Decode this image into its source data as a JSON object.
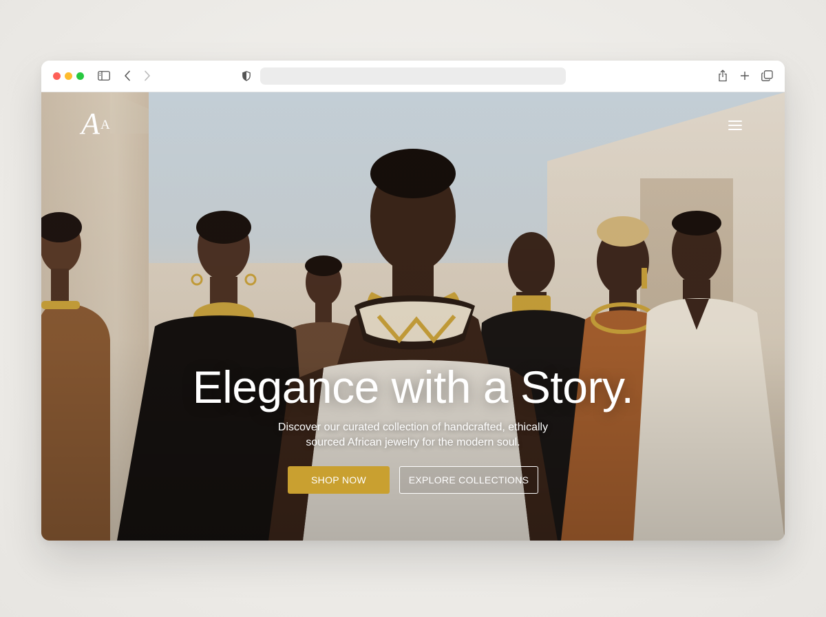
{
  "browser": {
    "address_value": "",
    "toolbar_icons": [
      "sidebar-icon",
      "back-icon",
      "forward-icon",
      "shield-icon",
      "share-icon",
      "new-tab-icon",
      "tabs-icon"
    ]
  },
  "site": {
    "logo": {
      "primary": "A",
      "secondary": "A"
    },
    "menu_icon": "hamburger-menu-icon"
  },
  "hero": {
    "title": "Elegance with a Story.",
    "subtitle_line1": "Discover our curated collection of handcrafted, ethically",
    "subtitle_line2": "sourced African jewelry for the modern soul.",
    "primary_button": "SHOP NOW",
    "secondary_button": "EXPLORE COLLECTIONS"
  },
  "colors": {
    "accent_gold": "#c9a030",
    "window_close": "#fe5f57",
    "window_minimize": "#febc2e",
    "window_maximize": "#28c840"
  }
}
